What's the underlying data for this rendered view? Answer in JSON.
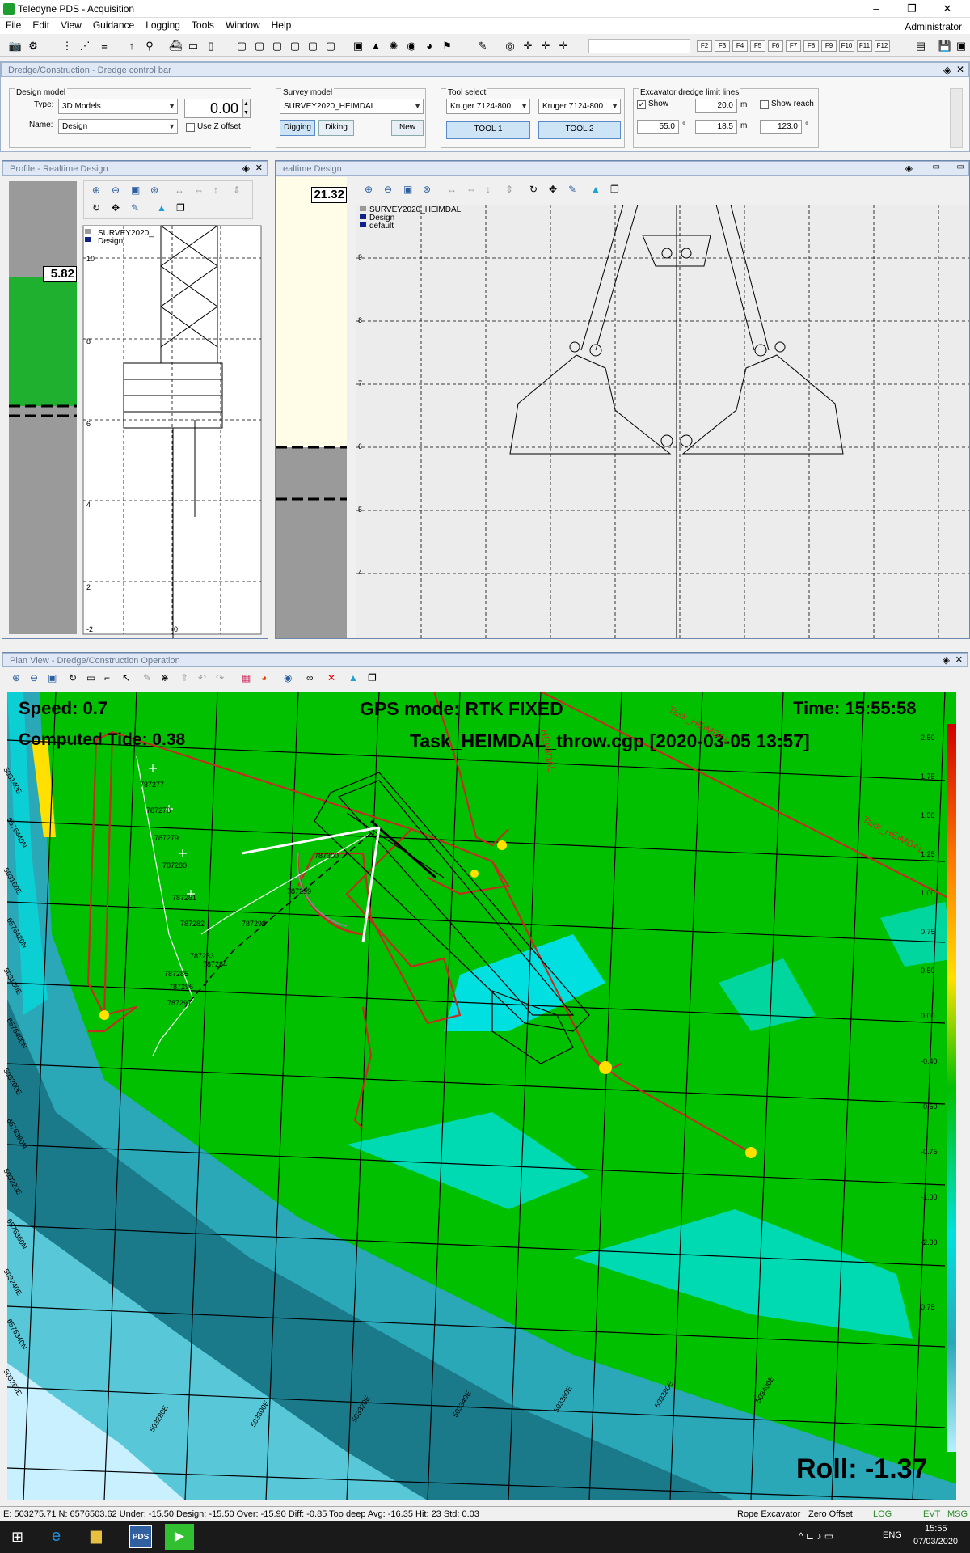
{
  "app": {
    "title": "Teledyne PDS - Acquisition",
    "user": "Administrator",
    "window_controls": [
      "minimize-icon",
      "restore-icon",
      "close-icon"
    ]
  },
  "menu": [
    "File",
    "Edit",
    "View",
    "Guidance",
    "Logging",
    "Tools",
    "Window",
    "Help"
  ],
  "fkeys": [
    "F2",
    "F3",
    "F4",
    "F5",
    "F6",
    "F7",
    "F8",
    "F9",
    "F10",
    "F11",
    "F12"
  ],
  "control_bar": {
    "title": "Dredge/Construction - Dredge control bar",
    "design_model": {
      "label": "Design model",
      "type_label": "Type:",
      "type_value": "3D Models",
      "name_label": "Name:",
      "name_value": "Design",
      "value": "0.00",
      "use_z_offset_label": "Use Z offset"
    },
    "survey_model": {
      "label": "Survey model",
      "value": "SURVEY2020_HEIMDAL",
      "buttons": [
        "Digging",
        "Diking",
        "New"
      ]
    },
    "tool_select": {
      "label": "Tool select",
      "tool1_value": "Kruger 7124-800",
      "tool2_value": "Kruger 7124-800",
      "tool1_button": "TOOL 1",
      "tool2_button": "TOOL 2"
    },
    "excavator_limits": {
      "label": "Excavator dredge limit lines",
      "show_label": "Show",
      "show_checked": true,
      "distance_value": "20.0",
      "distance_unit": "m",
      "show_reach_label": "Show reach",
      "show_reach_checked": false,
      "angle_value": "55.0",
      "angle_unit": "°",
      "depth_value": "18.5",
      "depth_unit": "m",
      "reach_angle_value": "123.0",
      "reach_angle_unit": "°"
    }
  },
  "profile_panel": {
    "title": "Profile - Realtime Design",
    "depth_readout": "5.82",
    "legend": [
      "SURVEY2020_",
      "Design"
    ],
    "axis_labels": [
      "10",
      "8",
      "6",
      "4",
      "2",
      "-2",
      "0"
    ]
  },
  "realtime_design_panel": {
    "title": "ealtime Design",
    "depth_readout": "21.32",
    "legend": [
      "SURVEY2020_HEIMDAL",
      "Design",
      "default"
    ],
    "axis_labels": [
      "9",
      "8",
      "7",
      "6",
      "5",
      "4"
    ]
  },
  "plan_view": {
    "title": "Plan View - Dredge/Construction Operation",
    "speed": "Speed: 0.7",
    "gps_mode": "GPS mode: RTK FIXED",
    "time": "Time: 15:55:58",
    "tide": "Computed Tide: 0.38",
    "task": "Task_HEIMDAL_throw.cgp [2020-03-05 13:57]",
    "roll": "Roll: -1.37",
    "line_labels": [
      "Task_HEIMDAL",
      "Task_HEIMDAL",
      "HEIMDAL"
    ],
    "station_labels": [
      "787277",
      "787278",
      "787279",
      "787280",
      "787281",
      "787282",
      "787283",
      "787284",
      "787285",
      "787296",
      "787297",
      "787298",
      "787299",
      "787300"
    ],
    "grid_labels_left": [
      "503140E",
      "6576440N",
      "503160E",
      "6576420N",
      "503180E",
      "6576400N",
      "503200E",
      "6576380N",
      "503220E",
      "6576360N",
      "503240E",
      "6576340N",
      "503260E"
    ],
    "grid_labels_bottom": [
      "503280E",
      "503300E",
      "503320E",
      "503340E",
      "503360E",
      "503380E",
      "503400E"
    ],
    "color_scale": [
      "2.50",
      "1.75",
      "1.50",
      "1.25",
      "1.00",
      "0.75",
      "0.50",
      "0.00",
      "-0.40",
      "-0.50",
      "-0.75",
      "-1.00",
      "-2.00",
      "0.75"
    ]
  },
  "status": {
    "text": "E: 503275.71 N: 6576503.62 Under: -15.50 Design: -15.50 Over: -15.90 Diff: -0.85 Too deep Avg: -16.35 Hit: 23 Std: 0.03",
    "mode": "Rope Excavator",
    "offset": "Zero Offset",
    "log": "LOG",
    "evt": "EVT",
    "msg": "MSG"
  },
  "taskbar": {
    "lang": "ENG",
    "time": "15:55",
    "date": "07/03/2020",
    "pds_label": "PDS"
  },
  "colors": {
    "green": "#00c000",
    "cyan": "#00e0e0",
    "teal": "#2aa8b8",
    "dark_teal": "#1a7a8a",
    "red_line": "#c03020",
    "accent_blue": "#2c5fa0"
  }
}
